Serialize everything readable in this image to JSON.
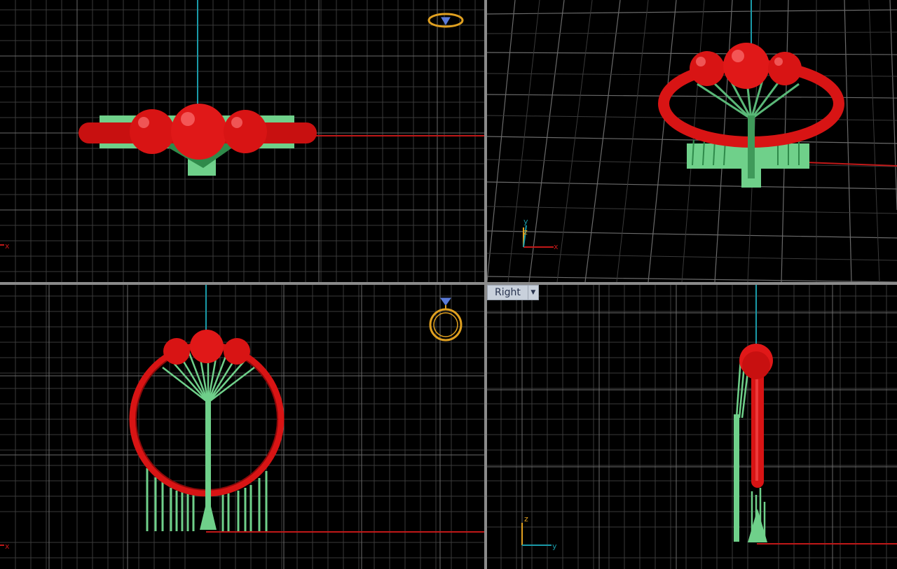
{
  "viewports": {
    "top": {
      "axes": {
        "x": "x"
      }
    },
    "perspective": {
      "axes": {
        "y": "y",
        "z": "z",
        "x": "x"
      }
    },
    "front": {
      "axes": {
        "x": "x"
      }
    },
    "right": {
      "label": "Right",
      "axes": {
        "z": "z",
        "y": "y"
      }
    }
  },
  "colors": {
    "background": "#000000",
    "grid": "#3a3a3a",
    "grid_major": "#7a7a7a",
    "ring": "#d81414",
    "support": "#6fd08a",
    "axis_x": "#c01818",
    "axis_z": "#1a9aa8",
    "gumball": "#e0a020",
    "gem_icon": "#5a7ad8"
  },
  "icons": {
    "label_menu": "chevron-down-icon",
    "gumball": "ring-widget-icon"
  }
}
